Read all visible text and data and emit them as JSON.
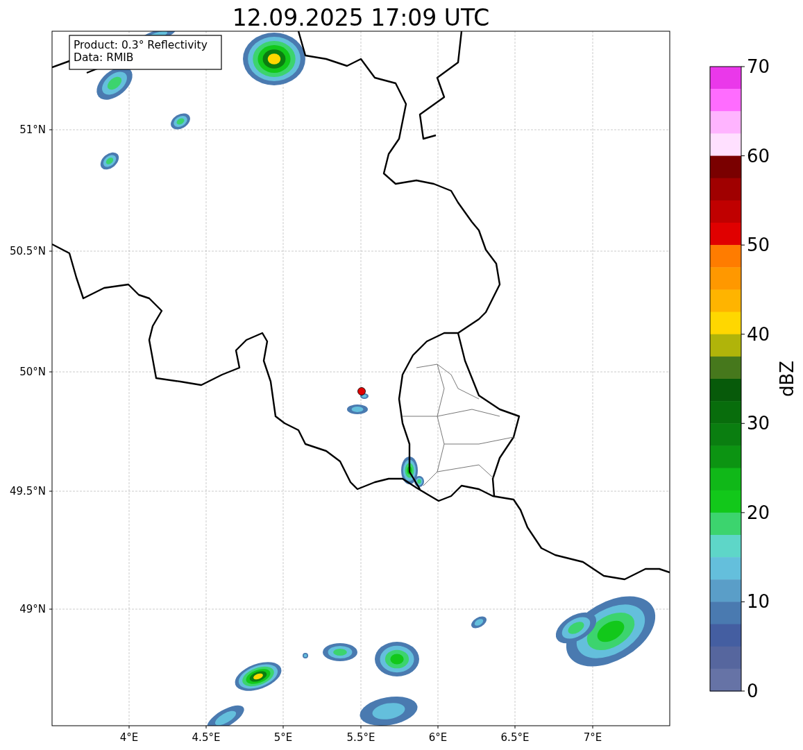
{
  "title": "12.09.2025 17:09 UTC",
  "info_box": [
    "Product: 0.3° Reflectivity",
    "Data: RMIB"
  ],
  "lat_ticks": [
    "51°N",
    "50.5°N",
    "50°N",
    "49.5°N",
    "49°N"
  ],
  "lon_ticks": [
    "4°E",
    "4.5°E",
    "5°E",
    "5.5°E",
    "6°E",
    "6.5°E",
    "7°E"
  ],
  "colorbar": {
    "label": "dBZ",
    "ticks": [
      "70",
      "60",
      "50",
      "40",
      "30",
      "20",
      "10",
      "0"
    ],
    "bins": [
      {
        "color": "#ea38ea"
      },
      {
        "color": "#ff6cff"
      },
      {
        "color": "#ffb4ff"
      },
      {
        "color": "#ffe0ff"
      },
      {
        "color": "#7a0000"
      },
      {
        "color": "#a00000"
      },
      {
        "color": "#c00000"
      },
      {
        "color": "#e00000"
      },
      {
        "color": "#ff7c00"
      },
      {
        "color": "#ff9800"
      },
      {
        "color": "#ffb400"
      },
      {
        "color": "#ffd700"
      },
      {
        "color": "#b0b40a"
      },
      {
        "color": "#46781c"
      },
      {
        "color": "#075a0a"
      },
      {
        "color": "#086d0c"
      },
      {
        "color": "#0a7e10"
      },
      {
        "color": "#0c9412"
      },
      {
        "color": "#10b818"
      },
      {
        "color": "#12c81a"
      },
      {
        "color": "#3cd46e"
      },
      {
        "color": "#5ed6c8"
      },
      {
        "color": "#64bfdc"
      },
      {
        "color": "#5a9ec8"
      },
      {
        "color": "#4a7ab0"
      },
      {
        "color": "#445ea1"
      },
      {
        "color": "#56669e"
      },
      {
        "color": "#6673a6"
      }
    ]
  }
}
